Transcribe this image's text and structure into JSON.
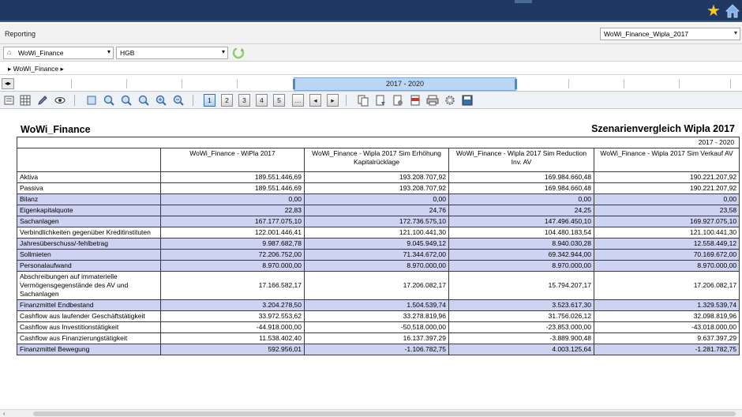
{
  "toolbar_top": {
    "star_icon": "star-icon",
    "home_icon": "home-icon"
  },
  "reporting": {
    "label": "Reporting",
    "report_select": "WoWi_Finance_Wipla_2017"
  },
  "filters": {
    "entity": "WoWi_Finance",
    "standard": "HGB"
  },
  "breadcrumb": {
    "item": "WoWi_Finance"
  },
  "timeline": {
    "period_label": "2017 - 2020"
  },
  "toolbar": {
    "page_buttons": [
      "1",
      "2",
      "3",
      "4",
      "5"
    ]
  },
  "report": {
    "title": "WoWi_Finance",
    "subtitle": "Szenarienvergleich Wipla 2017",
    "period": "2017 - 2020",
    "columns": [
      "WoWi_Finance - WiPla 2017",
      "WoWi_Finance - Wipla 2017 Sim Erhöhung Kapitalrücklage",
      "WoWi_Finance - Wipla 2017 Sim Reduction Inv. AV",
      "WoWi_Finance - Wipla 2017 Sim Verkauf AV"
    ],
    "rows": [
      {
        "label": "Aktiva",
        "values": [
          "189.551.446,69",
          "193.208.707,92",
          "169.984.660,48",
          "190.221.207,92"
        ]
      },
      {
        "label": "Passiva",
        "values": [
          "189.551.446,69",
          "193.208.707,92",
          "169.984.660,48",
          "190.221.207,92"
        ]
      },
      {
        "label": "Bilanz",
        "values": [
          "0,00",
          "0,00",
          "0,00",
          "0,00"
        ]
      },
      {
        "label": "Eigenkapitalquote",
        "values": [
          "22,83",
          "24,76",
          "24,25",
          "23,58"
        ]
      },
      {
        "label": "Sachanlagen",
        "values": [
          "167.177.075,10",
          "172.736.575,10",
          "147.496.450,10",
          "169.927.075,10"
        ]
      },
      {
        "label": "Verbindlichkeiten gegenüber Kreditinstituten",
        "values": [
          "122.001.446,41",
          "121.100.441,30",
          "104.480.183,54",
          "121.100.441,30"
        ]
      },
      {
        "label": "Jahresüberschuss/-fehlbetrag",
        "values": [
          "9.987.682,78",
          "9.045.949,12",
          "8.940.030,28",
          "12.558.449,12"
        ]
      },
      {
        "label": "Sollmieten",
        "values": [
          "72.206.752,00",
          "71.344.672,00",
          "69.342.944,00",
          "70.169.672,00"
        ]
      },
      {
        "label": "Personalaufwand",
        "values": [
          "8.970.000,00",
          "8.970.000,00",
          "8.970.000,00",
          "8.970.000,00"
        ]
      },
      {
        "label": "Abschreibungen auf immaterielle Vermögensgegenstände des AV und Sachanlagen",
        "values": [
          "17.166.582,17",
          "17.206.082,17",
          "15.794.207,17",
          "17.206.082,17"
        ]
      },
      {
        "label": "Finanzmittel Endbestand",
        "values": [
          "3.204.278,50",
          "1.504.539,74",
          "3.523.617,30",
          "1.329.539,74"
        ]
      },
      {
        "label": "Cashflow aus laufender Geschäftstätigkeit",
        "values": [
          "33.972.553,62",
          "33.278.819,96",
          "31.756.026,12",
          "32.098.819,96"
        ]
      },
      {
        "label": "Cashflow aus Investitionstätigkeit",
        "values": [
          "-44.918.000,00",
          "-50.518.000,00",
          "-23.853.000,00",
          "-43.018.000,00"
        ]
      },
      {
        "label": "Cashflow aus Finanzierungstätigkeit",
        "values": [
          "11.538.402,40",
          "16.137.397,29",
          "-3.889.900,48",
          "9.637.397,29"
        ]
      },
      {
        "label": "Finanzmittel Bewegung",
        "values": [
          "592.956,01",
          "-1.106.782,75",
          "4.003.125,64",
          "-1.281.782,75"
        ]
      }
    ],
    "highlight_rows": [
      2,
      3,
      4,
      6,
      7,
      8,
      10,
      14
    ]
  },
  "colors": {
    "accent": "#1f3864",
    "row_highlight": "#cfd3f2",
    "period_band": "#bcd6f5"
  }
}
